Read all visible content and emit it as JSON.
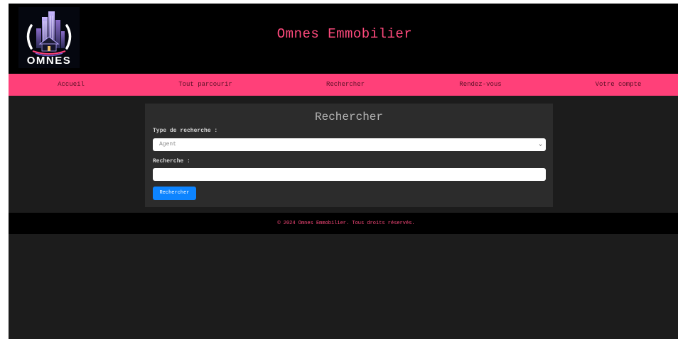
{
  "header": {
    "logo_text": "OMNES",
    "site_title": "Omnes Emmobilier"
  },
  "nav": {
    "items": [
      "Accueil",
      "Tout parcourir",
      "Rechercher",
      "Rendez-vous",
      "Votre compte"
    ]
  },
  "search": {
    "title": "Rechercher",
    "type_label": "Type de recherche :",
    "type_value": "Agent",
    "query_label": "Recherche :",
    "query_value": "",
    "submit_label": "Rechercher"
  },
  "footer": {
    "text": "© 2024 Omnes Emmobilier. Tous droits réservés."
  },
  "colors": {
    "accent": "#ff4079",
    "button": "#0d84ff",
    "background": "#1c1c1c",
    "header_bg": "#000000"
  },
  "icons": {
    "logo": "city-buildings-logo-icon",
    "select": "chevron-down-icon"
  }
}
